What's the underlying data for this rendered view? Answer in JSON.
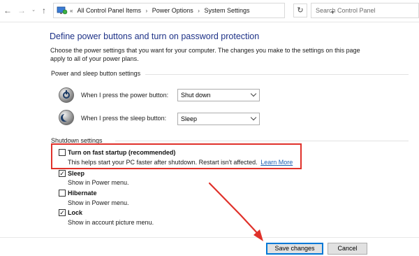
{
  "address_bar": {
    "crumbs": [
      "All Control Panel Items",
      "Power Options",
      "System Settings"
    ],
    "search_placeholder": "Search Control Panel"
  },
  "page": {
    "title": "Define power buttons and turn on password protection",
    "intro": "Choose the power settings that you want for your computer. The changes you make to the settings on this page apply to all of your power plans."
  },
  "power_section": {
    "heading": "Power and sleep button settings",
    "power_button": {
      "label": "When I press the power button:",
      "value": "Shut down"
    },
    "sleep_button": {
      "label": "When I press the sleep button:",
      "value": "Sleep"
    }
  },
  "shutdown_section": {
    "heading": "Shutdown settings",
    "options": [
      {
        "title": "Turn on fast startup (recommended)",
        "desc": "This helps start your PC faster after shutdown. Restart isn't affected.",
        "link": "Learn More",
        "checked": false
      },
      {
        "title": "Sleep",
        "desc": "Show in Power menu.",
        "checked": true
      },
      {
        "title": "Hibernate",
        "desc": "Show in Power menu.",
        "checked": false
      },
      {
        "title": "Lock",
        "desc": "Show in account picture menu.",
        "checked": true
      }
    ]
  },
  "buttons": {
    "save": "Save changes",
    "cancel": "Cancel"
  },
  "colors": {
    "title_blue": "#1e3287",
    "highlight_red": "#e0312a",
    "link_blue": "#1a5fb4"
  },
  "icons": [
    "back-arrow-icon",
    "forward-arrow-icon",
    "up-arrow-icon",
    "control-panel-icon",
    "refresh-icon",
    "power-button-icon",
    "sleep-button-icon",
    "checkmark-icon",
    "chevron-down-icon"
  ]
}
